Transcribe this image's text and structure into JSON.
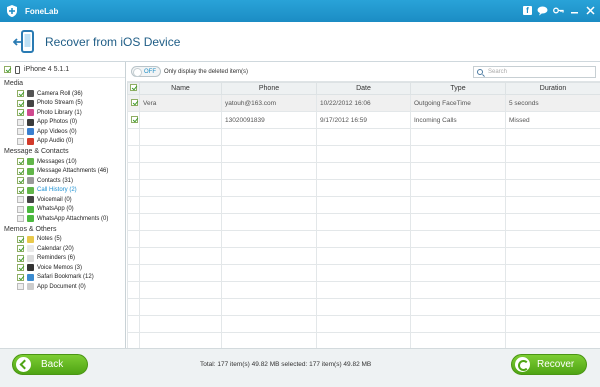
{
  "app": {
    "title": "FoneLab"
  },
  "header": {
    "title": "Recover from iOS Device"
  },
  "sidebar": {
    "device": "iPhone 4 5.1.1",
    "sections": [
      {
        "title": "Media",
        "items": [
          {
            "label": "Camera Roll (36)",
            "checked": true,
            "color": "#555555"
          },
          {
            "label": "Photo Stream (5)",
            "checked": true,
            "color": "#444444"
          },
          {
            "label": "Photo Library (1)",
            "checked": true,
            "color": "#d04a8f"
          },
          {
            "label": "App Photos (0)",
            "checked": false,
            "color": "#3a3a3a"
          },
          {
            "label": "App Videos (0)",
            "checked": false,
            "color": "#3a7fcf"
          },
          {
            "label": "App Audio (0)",
            "checked": false,
            "color": "#d23a2a"
          }
        ]
      },
      {
        "title": "Message & Contacts",
        "items": [
          {
            "label": "Messages (10)",
            "checked": true,
            "color": "#62b64a"
          },
          {
            "label": "Message Attachments (46)",
            "checked": true,
            "color": "#62b64a"
          },
          {
            "label": "Contacts (31)",
            "checked": true,
            "color": "#9a9a9a"
          },
          {
            "label": "Call History (2)",
            "checked": true,
            "color": "#62b64a",
            "selected": true
          },
          {
            "label": "Voicemail (0)",
            "checked": false,
            "color": "#444444"
          },
          {
            "label": "WhatsApp (0)",
            "checked": false,
            "color": "#4bb83f"
          },
          {
            "label": "WhatsApp Attachments (0)",
            "checked": false,
            "color": "#4bb83f"
          }
        ]
      },
      {
        "title": "Memos & Others",
        "items": [
          {
            "label": "Notes (5)",
            "checked": true,
            "color": "#e8c84a"
          },
          {
            "label": "Calendar (20)",
            "checked": true,
            "color": "#e9e9e9"
          },
          {
            "label": "Reminders (6)",
            "checked": true,
            "color": "#dddddd"
          },
          {
            "label": "Voice Memos (3)",
            "checked": true,
            "color": "#333333"
          },
          {
            "label": "Safari Bookmark (12)",
            "checked": true,
            "color": "#3b8bd0"
          },
          {
            "label": "App Document (0)",
            "checked": false,
            "color": "#cccccc"
          }
        ]
      }
    ]
  },
  "toolbar": {
    "toggle_label": "OFF",
    "filter_label": "Only display the deleted item(s)",
    "search_placeholder": "Search"
  },
  "table": {
    "columns": [
      "",
      "Name",
      "Phone",
      "Date",
      "Type",
      "Duration"
    ],
    "rows": [
      {
        "checked": true,
        "name": "Vera",
        "phone": "yatouh@163.com",
        "date": "10/22/2012 16:06",
        "type": "Outgoing FaceTime",
        "duration": "5 seconds"
      },
      {
        "checked": true,
        "name": "",
        "phone": "13020091839",
        "date": "9/17/2012 16:59",
        "type": "Incoming Calls",
        "duration": "Missed"
      }
    ]
  },
  "footer": {
    "back_label": "Back",
    "recover_label": "Recover",
    "totals": "Total: 177 item(s) 49.82 MB   selected: 177 item(s) 49.82 MB"
  },
  "colors": {
    "accent": "#1b8cc4",
    "green": "#5cb41d"
  }
}
